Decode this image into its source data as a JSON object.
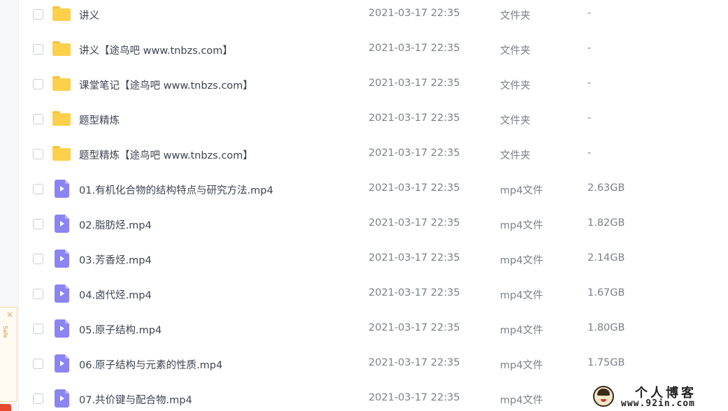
{
  "files": [
    {
      "name": "讲义",
      "date": "2021-03-17 22:35",
      "type": "文件夹",
      "size": "-",
      "icon": "folder-icon"
    },
    {
      "name": "讲义【途鸟吧 www.tnbzs.com】",
      "date": "2021-03-17 22:35",
      "type": "文件夹",
      "size": "-",
      "icon": "folder-icon"
    },
    {
      "name": "课堂笔记【途鸟吧 www.tnbzs.com】",
      "date": "2021-03-17 22:35",
      "type": "文件夹",
      "size": "-",
      "icon": "folder-icon"
    },
    {
      "name": "题型精炼",
      "date": "2021-03-17 22:35",
      "type": "文件夹",
      "size": "-",
      "icon": "folder-icon"
    },
    {
      "name": "题型精炼【途鸟吧 www.tnbzs.com】",
      "date": "2021-03-17 22:35",
      "type": "文件夹",
      "size": "-",
      "icon": "folder-icon"
    },
    {
      "name": "01.有机化合物的结构特点与研究方法.mp4",
      "date": "2021-03-17 22:35",
      "type": "mp4文件",
      "size": "2.63GB",
      "icon": "video-file-icon"
    },
    {
      "name": "02.脂肪烃.mp4",
      "date": "2021-03-17 22:35",
      "type": "mp4文件",
      "size": "1.82GB",
      "icon": "video-file-icon"
    },
    {
      "name": "03.芳香烃.mp4",
      "date": "2021-03-17 22:35",
      "type": "mp4文件",
      "size": "2.14GB",
      "icon": "video-file-icon"
    },
    {
      "name": "04.卤代烃.mp4",
      "date": "2021-03-17 22:35",
      "type": "mp4文件",
      "size": "1.67GB",
      "icon": "video-file-icon"
    },
    {
      "name": "05.原子结构.mp4",
      "date": "2021-03-17 22:35",
      "type": "mp4文件",
      "size": "1.80GB",
      "icon": "video-file-icon"
    },
    {
      "name": "06.原子结构与元素的性质.mp4",
      "date": "2021-03-17 22:35",
      "type": "mp4文件",
      "size": "1.75GB",
      "icon": "video-file-icon"
    },
    {
      "name": "07.共价键与配合物.mp4",
      "date": "2021-03-17 22:35",
      "type": "mp4文件",
      "size": "",
      "icon": "video-file-icon"
    }
  ],
  "popup": {
    "close": "×",
    "text": "Safe"
  },
  "watermark": {
    "title": "个人博客",
    "url": "www.92in.com"
  },
  "colors": {
    "folder": "#fcd04b",
    "video": "#8b84f2",
    "popup_accent": "#e0a95a",
    "badge": "#e8492e"
  }
}
